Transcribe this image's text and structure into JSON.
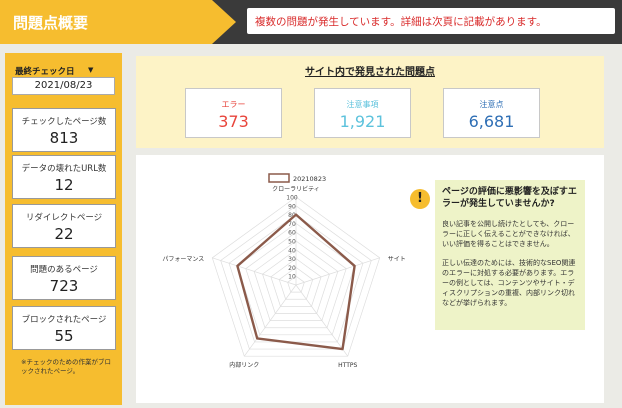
{
  "header": {
    "title": "問題点概要",
    "alert": "複数の問題が発生しています。詳細は次頁に記載があります。"
  },
  "sidebar": {
    "filter_label": "最終チェック日",
    "date_value": "2021/08/23",
    "stats": [
      {
        "label": "チェックしたページ数",
        "value": "813"
      },
      {
        "label": "データの壊れたURL数",
        "value": "12"
      },
      {
        "label": "リダイレクトページ",
        "value": "22"
      },
      {
        "label": "問題のあるページ",
        "value": "723"
      },
      {
        "label": "ブロックされたページ",
        "value": "55"
      }
    ],
    "note": "※チェックのための作業がブロックされたページ。"
  },
  "summary": {
    "title": "サイト内で発見された問題点",
    "kpis": [
      {
        "label": "エラー",
        "value": "373",
        "color": "#e8453c"
      },
      {
        "label": "注意事項",
        "value": "1,921",
        "color": "#5cc2dc"
      },
      {
        "label": "注意点",
        "value": "6,681",
        "color": "#2f6fb5"
      }
    ]
  },
  "chart_data": {
    "type": "radar",
    "series": [
      {
        "name": "20210823",
        "values": [
          80,
          70,
          90,
          75,
          70
        ],
        "color": "#8b5a4a"
      }
    ],
    "categories": [
      "クローラリビティ",
      "サイトヘルス",
      "HTTPS",
      "内部リンク",
      "パフォーマンス"
    ],
    "ticks": [
      "10",
      "20",
      "30",
      "40",
      "50",
      "60",
      "70",
      "80",
      "90",
      "100"
    ],
    "range": [
      0,
      100
    ],
    "legend": "top"
  },
  "warning": {
    "icon": "!",
    "title": "ページの評価に悪影響を及ぼすエラーが発生していませんか?",
    "para1": "良い記事を公開し続けたとしても、クローラーに正しく伝えることができなければ、いい評価を得ることはできません。",
    "para2": "正しい伝達のためには、技術的なSEO関連のエラーに対処する必要があります。エラーの例としては、コンテンツやサイト・ディスクリプションの重複、内部リンク切れなどが挙げられます。"
  }
}
